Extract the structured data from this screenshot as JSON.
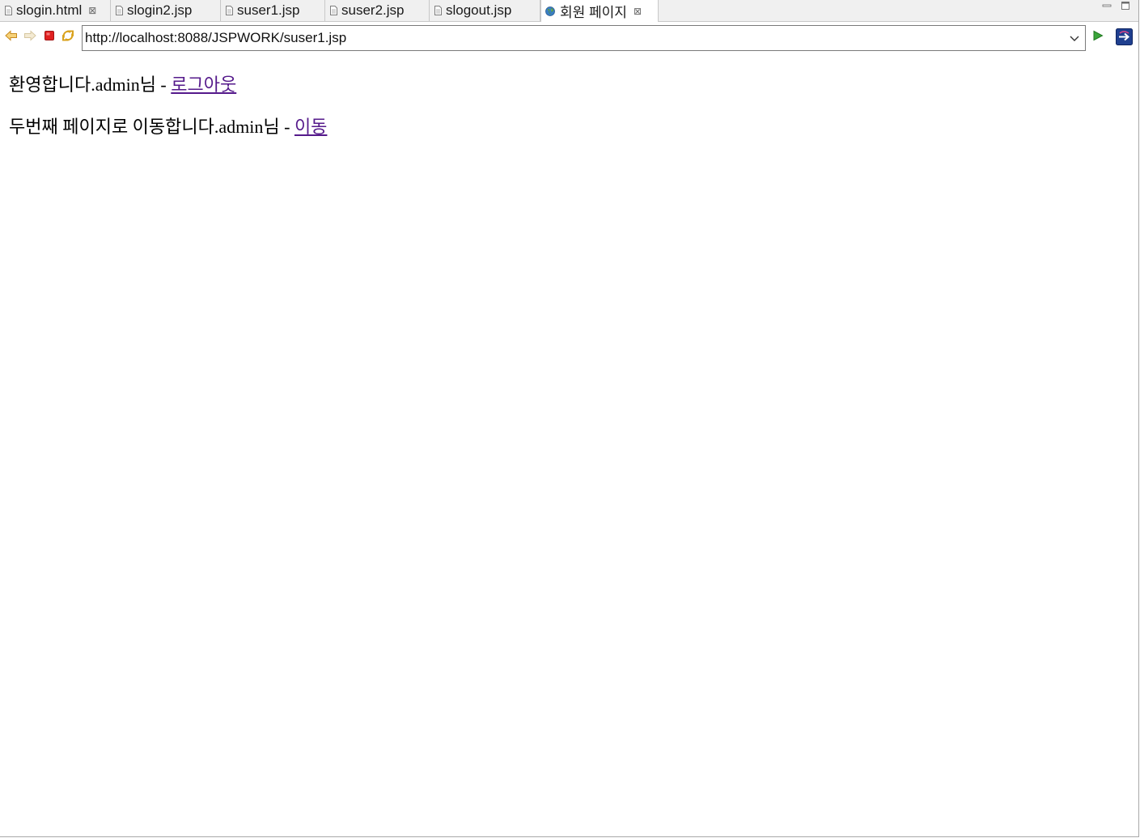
{
  "tabs": [
    {
      "label": "slogin.html",
      "icon": "file-icon",
      "closable": true
    },
    {
      "label": "slogin2.jsp",
      "icon": "file-icon",
      "closable": false
    },
    {
      "label": "suser1.jsp",
      "icon": "file-icon",
      "closable": false
    },
    {
      "label": "suser2.jsp",
      "icon": "file-icon",
      "closable": false
    },
    {
      "label": "slogout.jsp",
      "icon": "file-icon",
      "closable": false
    },
    {
      "label": "회원 페이지",
      "icon": "globe-icon",
      "closable": true,
      "active": true
    }
  ],
  "toolbar": {
    "url": "http://localhost:8088/JSPWORK/suser1.jsp"
  },
  "page": {
    "welcome_text": "환영합니다.admin님 - ",
    "logout_link": "로그아웃",
    "second_text": "두번째 페이지로 이동합니다.admin님 - ",
    "move_link": "이동"
  },
  "colors": {
    "visited_link": "#551a8b",
    "stop_red": "#e02020",
    "nav_arrow": "#e8a33a"
  }
}
